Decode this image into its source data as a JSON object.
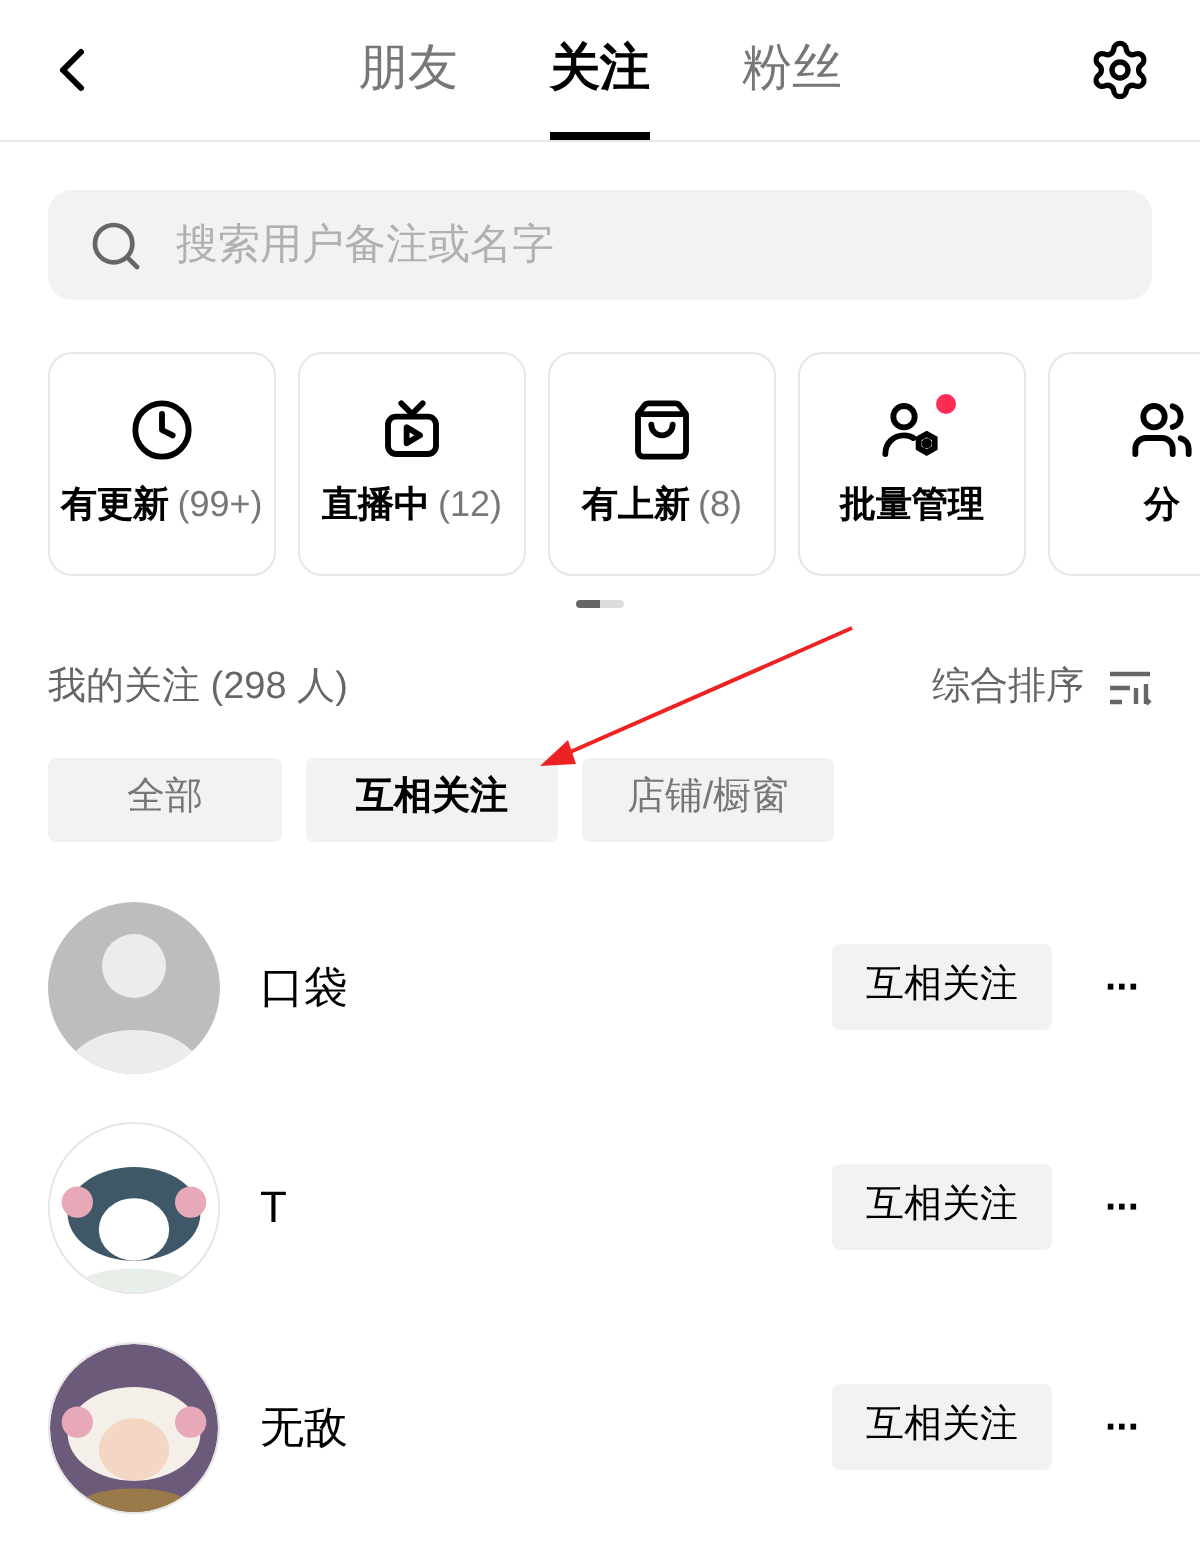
{
  "header": {
    "tabs": [
      {
        "label": "朋友",
        "selected": false
      },
      {
        "label": "关注",
        "selected": true
      },
      {
        "label": "粉丝",
        "selected": false
      }
    ]
  },
  "search": {
    "placeholder": "搜索用户备注或名字"
  },
  "shortcuts": [
    {
      "kind": "clock",
      "label": "有更新",
      "count": "(99+)",
      "dot": false
    },
    {
      "kind": "tv",
      "label": "直播中",
      "count": "(12)",
      "dot": false
    },
    {
      "kind": "bag",
      "label": "有上新",
      "count": "(8)",
      "dot": false
    },
    {
      "kind": "manage",
      "label": "批量管理",
      "dot": true
    },
    {
      "kind": "group",
      "label": "分",
      "dot": false
    }
  ],
  "pager": [
    {
      "selected": true
    },
    {
      "selected": false
    }
  ],
  "section": {
    "title": "我的关注 (298 人)",
    "sort": "综合排序"
  },
  "filters": [
    {
      "label": "全部",
      "selected": false
    },
    {
      "label": "互相关注",
      "selected": true
    },
    {
      "label": "店铺/橱窗",
      "selected": false
    }
  ],
  "users": [
    {
      "name": "口袋",
      "kind": "default",
      "button": "互相关注",
      "more": "···"
    },
    {
      "name": "T",
      "kind": "picture",
      "button": "互相关注",
      "more": "···"
    },
    {
      "name": "无敌",
      "kind": "picture",
      "button": "互相关注",
      "more": "···"
    }
  ]
}
